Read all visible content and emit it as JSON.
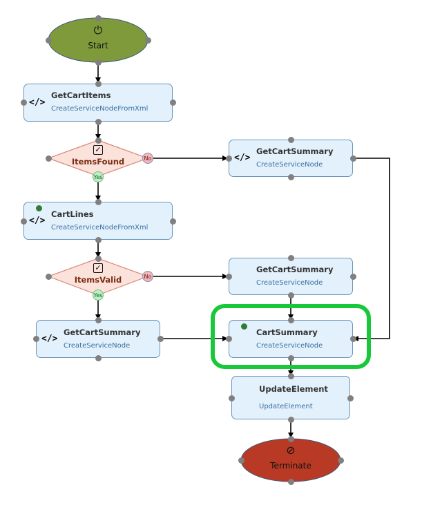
{
  "diagram": {
    "start": {
      "label": "Start",
      "icon": "power-icon",
      "fill": "#7f9a3a"
    },
    "terminate": {
      "label": "Terminate",
      "icon": "prohibited-icon",
      "fill": "#b83a25"
    },
    "nodes": [
      {
        "id": "getcartitems",
        "title": "GetCartItems",
        "subtitle": "CreateServiceNodeFromXml",
        "icon": "code-icon"
      },
      {
        "id": "cartlines",
        "title": "CartLines",
        "subtitle": "CreateServiceNodeFromXml",
        "icon": "code-icon",
        "status_dot": true
      },
      {
        "id": "getcartsummary-left",
        "title": "GetCartSummary",
        "subtitle": "CreateServiceNode",
        "icon": "code-icon"
      },
      {
        "id": "getcartsummary-top-right",
        "title": "GetCartSummary",
        "subtitle": "CreateServiceNode",
        "icon": "code-icon"
      },
      {
        "id": "getcartsummary-mid-right",
        "title": "GetCartSummary",
        "subtitle": "CreateServiceNode"
      },
      {
        "id": "cartsummary",
        "title": "CartSummary",
        "subtitle": "CreateServiceNode",
        "status_dot": true,
        "highlighted": true
      },
      {
        "id": "updateelement",
        "title": "UpdateElement",
        "subtitle": "UpdateElement"
      }
    ],
    "decisions": [
      {
        "id": "itemsfound",
        "label": "ItemsFound",
        "icon": "checkbox-icon",
        "yes": "Yes",
        "no": "No"
      },
      {
        "id": "itemsvalid",
        "label": "ItemsValid",
        "icon": "checkbox-icon",
        "yes": "Yes",
        "no": "No"
      }
    ],
    "code_glyph": "</>",
    "highlight_color": "#18c83a"
  }
}
